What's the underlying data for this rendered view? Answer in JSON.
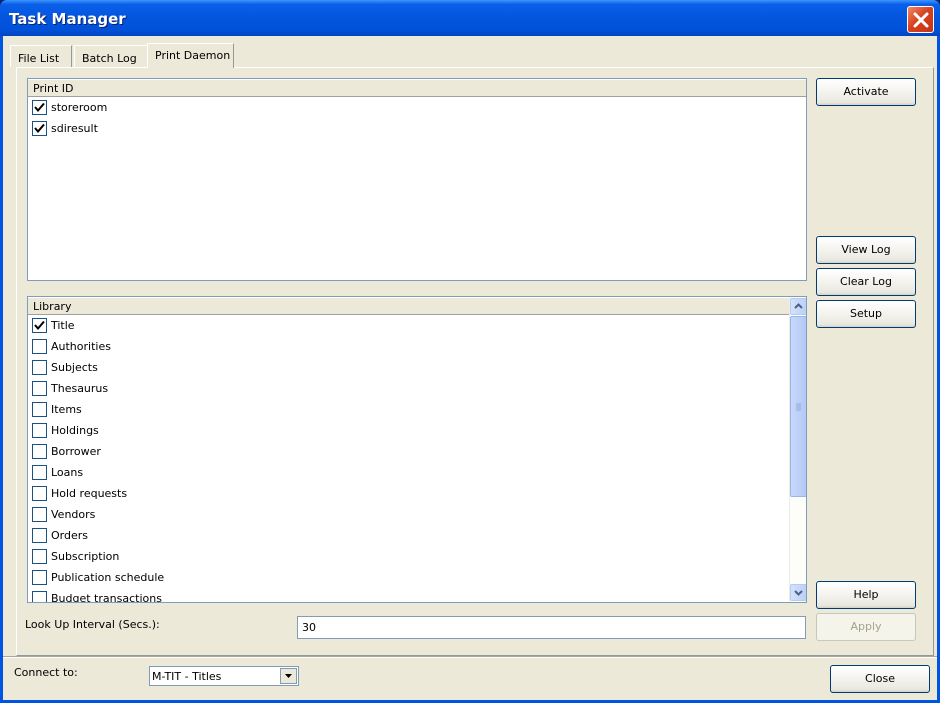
{
  "window": {
    "title": "Task Manager"
  },
  "tabs": [
    {
      "label": "File List"
    },
    {
      "label": "Batch Log"
    },
    {
      "label": "Print Daemon"
    }
  ],
  "print_list": {
    "header": "Print ID",
    "items": [
      {
        "label": "storeroom",
        "checked": true
      },
      {
        "label": "sdiresult",
        "checked": true
      }
    ]
  },
  "library_list": {
    "header": "Library",
    "items": [
      {
        "label": "Title",
        "checked": true
      },
      {
        "label": "Authorities",
        "checked": false
      },
      {
        "label": "Subjects",
        "checked": false
      },
      {
        "label": "Thesaurus",
        "checked": false
      },
      {
        "label": "Items",
        "checked": false
      },
      {
        "label": "Holdings",
        "checked": false
      },
      {
        "label": "Borrower",
        "checked": false
      },
      {
        "label": "Loans",
        "checked": false
      },
      {
        "label": "Hold requests",
        "checked": false
      },
      {
        "label": "Vendors",
        "checked": false
      },
      {
        "label": "Orders",
        "checked": false
      },
      {
        "label": "Subscription",
        "checked": false
      },
      {
        "label": "Publication schedule",
        "checked": false
      },
      {
        "label": "Budget transactions",
        "checked": false
      }
    ]
  },
  "buttons": {
    "activate": "Activate",
    "view_log": "View Log",
    "clear_log": "Clear Log",
    "setup": "Setup",
    "help": "Help",
    "apply": "Apply",
    "close": "Close"
  },
  "interval": {
    "label": "Look Up Interval (Secs.):",
    "value": "30"
  },
  "connect": {
    "label": "Connect to:",
    "value": "M-TIT - Titles"
  }
}
